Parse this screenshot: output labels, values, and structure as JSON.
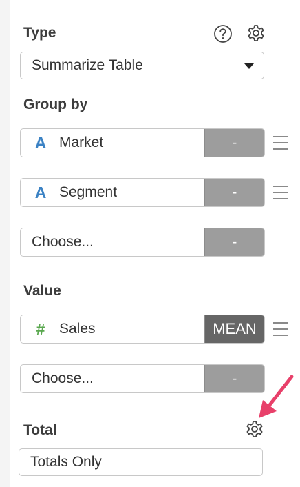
{
  "type_section": {
    "label": "Type",
    "help_icon": "help-circle-icon",
    "settings_icon": "gear-icon",
    "selected": "Summarize Table"
  },
  "group_by": {
    "label": "Group by",
    "fields": [
      {
        "icon": "A",
        "name": "Market",
        "agg": "-"
      },
      {
        "icon": "A",
        "name": "Segment",
        "agg": "-"
      }
    ],
    "chooser": {
      "name": "Choose...",
      "agg": "-"
    }
  },
  "value_section": {
    "label": "Value",
    "fields": [
      {
        "icon": "#",
        "name": "Sales",
        "agg": "MEAN"
      }
    ],
    "chooser": {
      "name": "Choose...",
      "agg": "-"
    }
  },
  "total_section": {
    "label": "Total",
    "settings_icon": "gear-icon",
    "selected": "Totals Only"
  },
  "colors": {
    "accent_arrow": "#e8406a",
    "string_icon": "#3b82c4",
    "number_icon": "#5aa84f",
    "agg_gray": "#9d9d9d",
    "agg_dark": "#666666"
  }
}
